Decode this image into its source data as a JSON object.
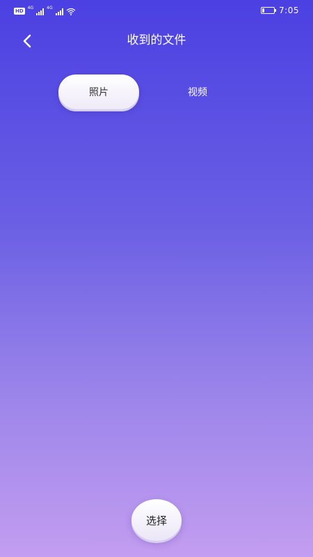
{
  "status_bar": {
    "hd_label": "HD",
    "network_1": "4G",
    "network_2": "4G",
    "time": "7:05",
    "battery_percent": 20
  },
  "header": {
    "title": "收到的文件",
    "back_icon": "chevron-left-icon"
  },
  "tabs": [
    {
      "label": "照片",
      "active": true
    },
    {
      "label": "视频",
      "active": false
    }
  ],
  "actions": {
    "select_label": "选择"
  },
  "colors": {
    "gradient_top": "#4b40e2",
    "gradient_bottom": "#c39df0",
    "pill_bg": "#ffffff",
    "pill_text": "#333333"
  }
}
